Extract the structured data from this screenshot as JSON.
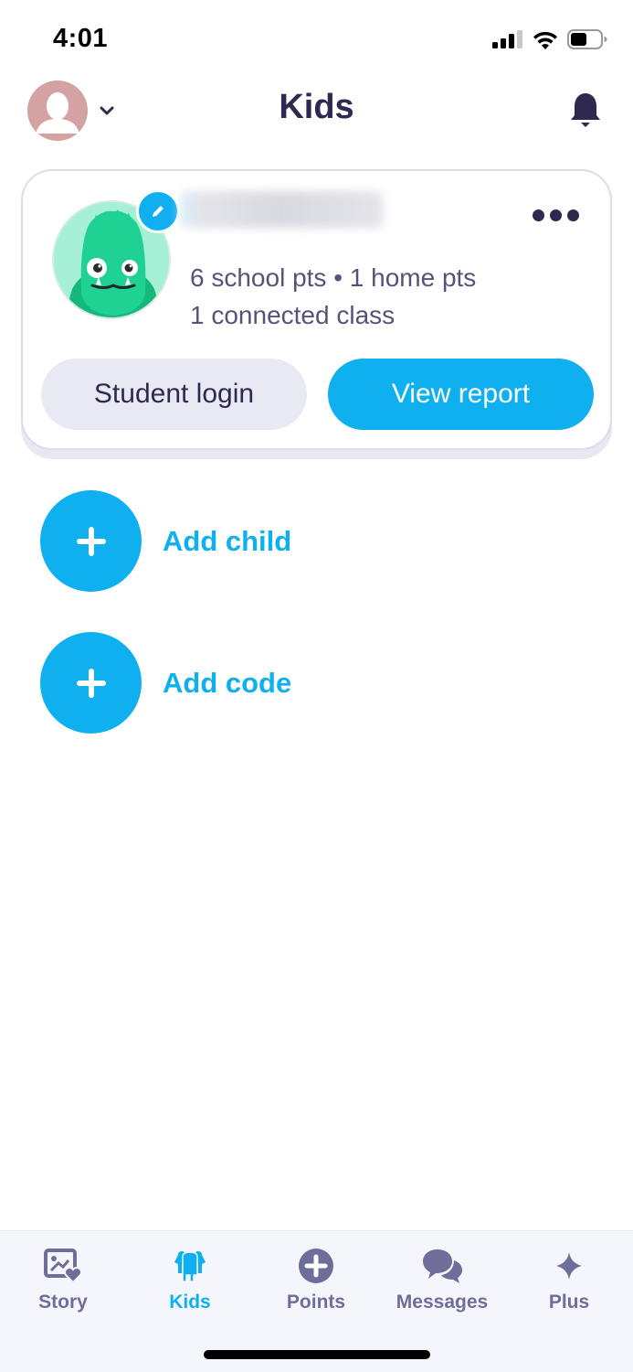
{
  "status_bar": {
    "time": "4:01",
    "icons": [
      "cellular-signal-icon",
      "wifi-icon",
      "battery-icon"
    ]
  },
  "header": {
    "title": "Kids",
    "left_icon": "user-avatar-icon",
    "left_dropdown_icon": "chevron-down-icon",
    "right_icon": "bell-icon"
  },
  "kid_card": {
    "name": "",
    "name_redacted": true,
    "avatar_icon": "green-monster-avatar",
    "edit_icon": "pencil-icon",
    "more_icon": "more-horizontal-icon",
    "stats_line1": "6 school pts • 1 home pts",
    "stats_line2": "1 connected class",
    "student_login_label": "Student login",
    "view_report_label": "View report"
  },
  "actions": [
    {
      "label": "Add child",
      "icon": "plus-icon"
    },
    {
      "label": "Add code",
      "icon": "plus-icon"
    }
  ],
  "tabbar": {
    "active": "Kids",
    "tabs": [
      {
        "label": "Story",
        "icon": "story-photo-heart-icon"
      },
      {
        "label": "Kids",
        "icon": "kids-icon"
      },
      {
        "label": "Points",
        "icon": "plus-circle-icon"
      },
      {
        "label": "Messages",
        "icon": "chat-bubbles-icon"
      },
      {
        "label": "Plus",
        "icon": "sparkle-icon"
      }
    ]
  },
  "colors": {
    "accent": "#0eb0f0",
    "primary_text": "#2c2a50",
    "secondary_text": "#55537a",
    "tab_inactive": "#6f6d9a",
    "avatar_bg": "#d4a2a2",
    "kid_avatar_bg": "#a5f0d6",
    "secondary_button_bg": "#e8e9f2"
  }
}
